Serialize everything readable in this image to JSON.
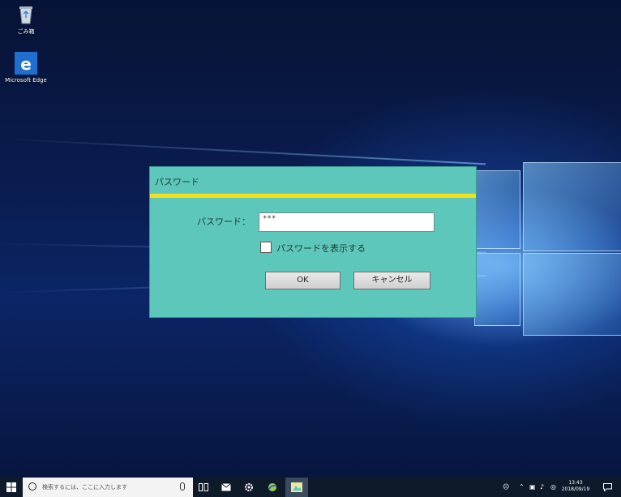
{
  "desktop": {
    "icons": [
      {
        "name": "recycle-bin",
        "label": "ごみ箱"
      },
      {
        "name": "edge",
        "label": "Microsoft Edge"
      }
    ]
  },
  "dialog": {
    "title": "パスワード",
    "password_label": "パスワード：",
    "password_value": "***",
    "show_password_label": "パスワードを表示する",
    "show_password_checked": false,
    "ok_label": "OK",
    "cancel_label": "キャンセル"
  },
  "taskbar": {
    "search_placeholder": "検索するには、ここに入力します",
    "clock_time": "13:43",
    "clock_date": "2018/09/19"
  },
  "colors": {
    "dialog_bg": "#5ec7bb",
    "dialog_stripe": "#f5e11b",
    "taskbar_bg": "#0e1a2a"
  }
}
